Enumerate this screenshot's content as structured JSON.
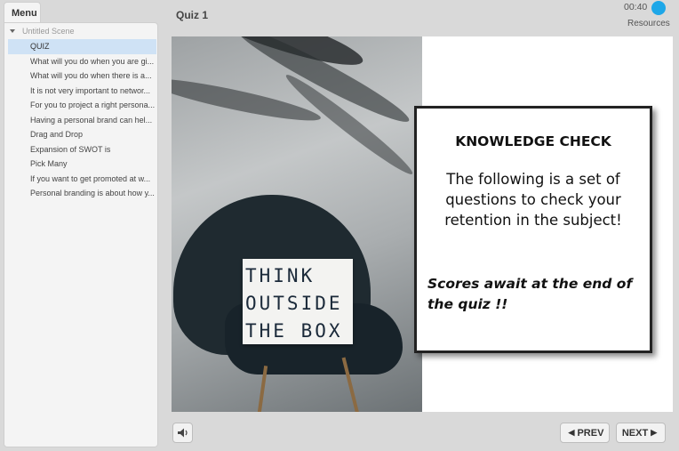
{
  "menu": {
    "tab_label": "Menu"
  },
  "sidebar": {
    "scene_label": "Untitled Scene",
    "items": [
      {
        "label": "QUIZ",
        "active": true
      },
      {
        "label": "What will you do when you are gi..."
      },
      {
        "label": "What will you do when there is a..."
      },
      {
        "label": "It is not very important to networ..."
      },
      {
        "label": "For you to project a right persona..."
      },
      {
        "label": "Having a personal brand can hel..."
      },
      {
        "label": "Drag and Drop"
      },
      {
        "label": "Expansion of SWOT is"
      },
      {
        "label": "Pick Many"
      },
      {
        "label": "If you want to get promoted at w..."
      },
      {
        "label": "Personal branding is about how y..."
      }
    ]
  },
  "header": {
    "title": "Quiz 1",
    "timer": "00:40",
    "resources_label": "Resources"
  },
  "slide": {
    "sign_lines": [
      "THINK",
      "OUTSIDE",
      "THE BOX"
    ],
    "card": {
      "title": "KNOWLEDGE CHECK",
      "body": "The following is a set of questions to check your retention in the subject!",
      "note": "Scores await at the end of the quiz !!"
    }
  },
  "footer": {
    "prev_label": "PREV",
    "next_label": "NEXT"
  },
  "colors": {
    "timer_accent": "#1ea7e8",
    "active_item_bg": "#cfe2f5"
  },
  "icons": {
    "scene_toggle": "triangle-down-icon",
    "audio": "speaker-icon",
    "prev": "chevron-left-icon",
    "next": "chevron-right-icon"
  }
}
